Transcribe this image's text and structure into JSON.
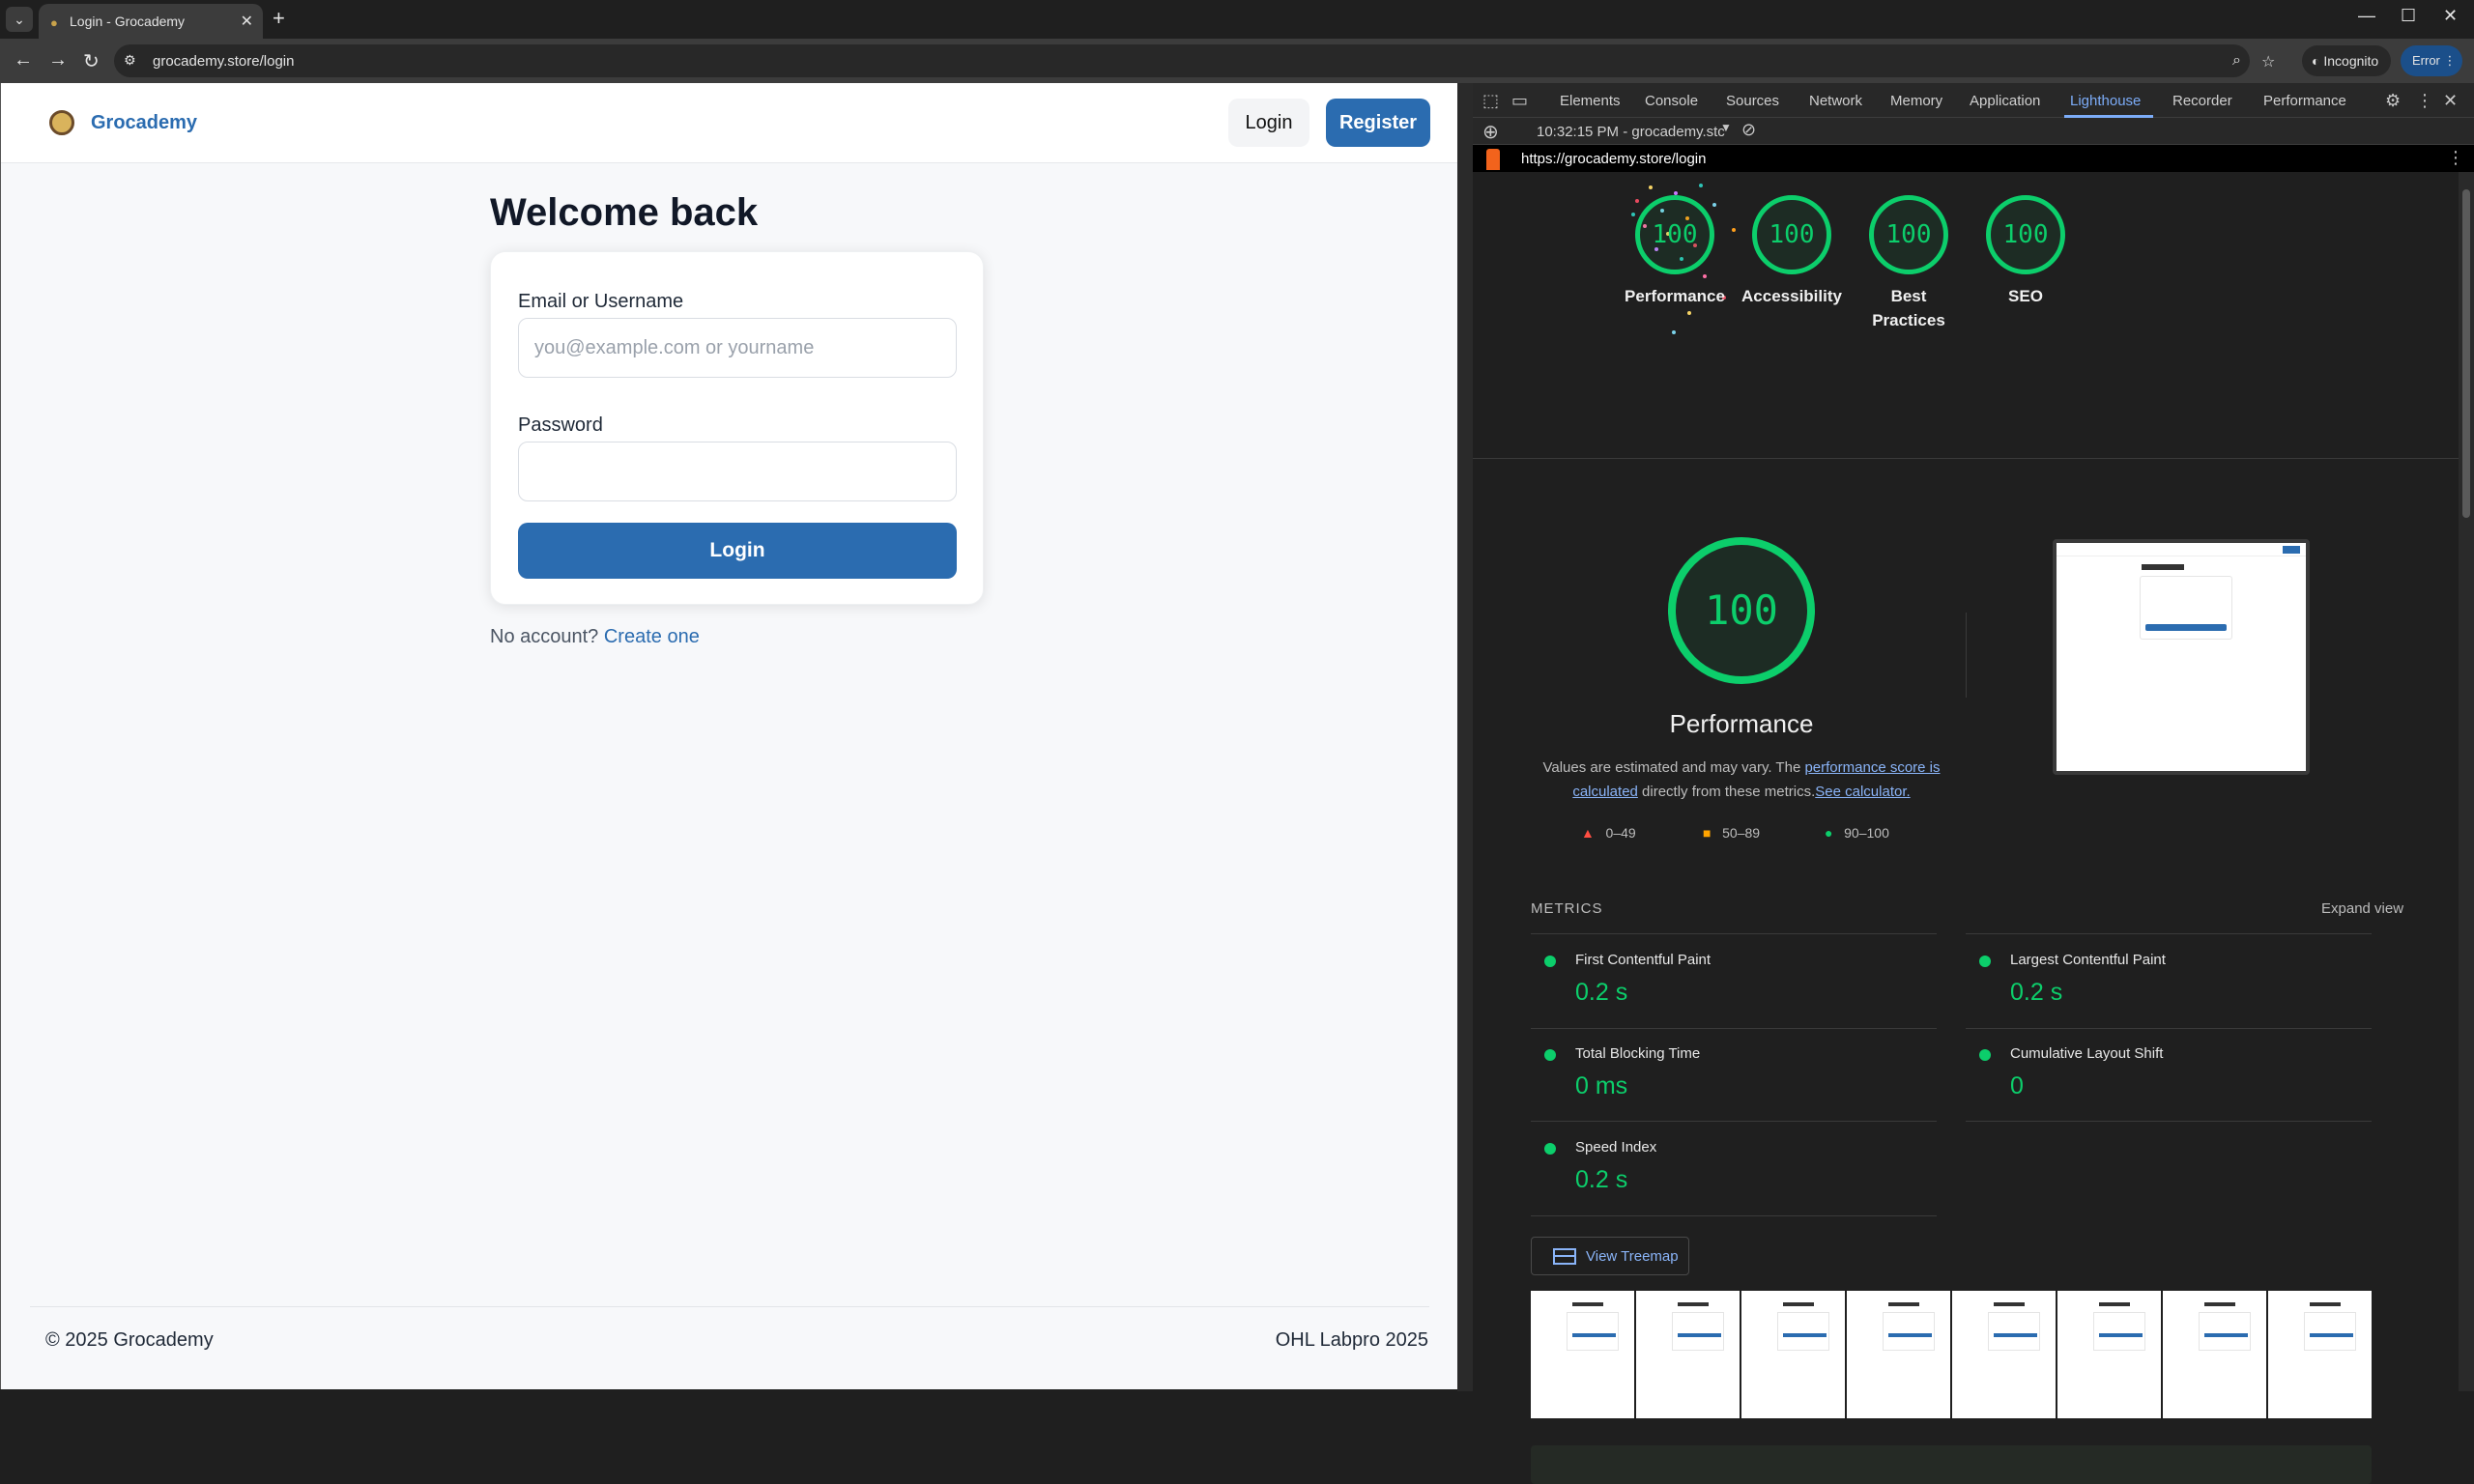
{
  "browser": {
    "tab_title": "Login - Grocademy",
    "url": "grocademy.store/login",
    "incognito_label": "Incognito",
    "error_label": "Error"
  },
  "site": {
    "brand": "Grocademy",
    "header_login": "Login",
    "header_register": "Register",
    "heading": "Welcome back",
    "email_label": "Email or Username",
    "email_placeholder": "you@example.com or yourname",
    "email_value": "",
    "password_label": "Password",
    "password_value": "",
    "login_button": "Login",
    "no_account_text": "No account?",
    "create_link": "Create one",
    "footer_left": "© 2025 Grocademy",
    "footer_right": "OHL Labpro 2025"
  },
  "devtools": {
    "tabs": [
      "Elements",
      "Console",
      "Sources",
      "Network",
      "Memory",
      "Application",
      "Lighthouse",
      "Recorder",
      "Performance"
    ],
    "active_tab": "Lighthouse",
    "report_selector": "10:32:15 PM - grocademy.stc",
    "report_url": "https://grocademy.store/login",
    "scores": [
      {
        "label": "Performance",
        "value": "100"
      },
      {
        "label": "Accessibility",
        "value": "100"
      },
      {
        "label": "Best Practices",
        "value": "100"
      },
      {
        "label": "SEO",
        "value": "100"
      }
    ],
    "perf_score": "100",
    "perf_title": "Performance",
    "perf_desc_1": "Values are estimated and may vary. The ",
    "perf_desc_link1": "performance score is calculated",
    "perf_desc_2": " directly from these metrics.",
    "perf_desc_link2": "See calculator.",
    "legend": {
      "fail": "0–49",
      "average": "50–89",
      "pass": "90–100"
    },
    "metrics_title": "METRICS",
    "expand_view": "Expand view",
    "metrics": [
      {
        "name": "First Contentful Paint",
        "value": "0.2 s"
      },
      {
        "name": "Largest Contentful Paint",
        "value": "0.2 s"
      },
      {
        "name": "Total Blocking Time",
        "value": "0 ms"
      },
      {
        "name": "Cumulative Layout Shift",
        "value": "0"
      },
      {
        "name": "Speed Index",
        "value": "0.2 s"
      }
    ],
    "treemap_label": "View Treemap",
    "filmstrip_frames": 8
  },
  "colors": {
    "brand_blue": "#2b6cb0",
    "pass_green": "#0cce6b",
    "average_orange": "#ffa400",
    "fail_red": "#ff4e42",
    "devtools_accent": "#7cacf8"
  }
}
